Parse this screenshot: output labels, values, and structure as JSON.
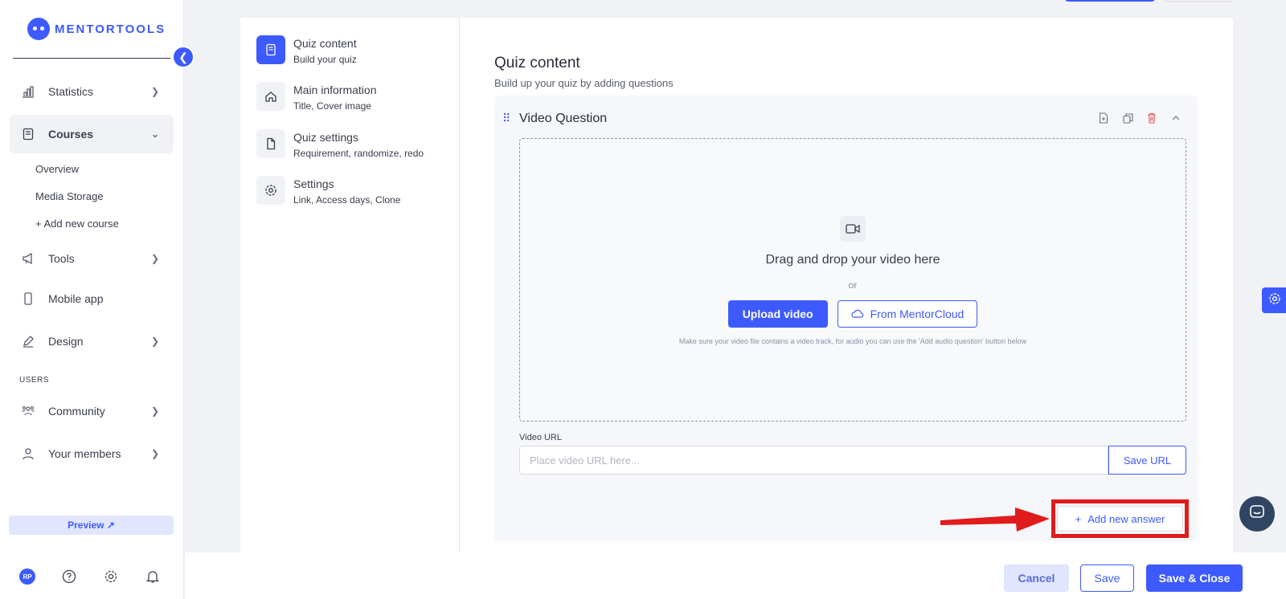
{
  "brand": {
    "name": "MENTORTOOLS"
  },
  "sidebar": {
    "items": [
      {
        "label": "Statistics",
        "icon": "bar-chart-icon"
      },
      {
        "label": "Courses",
        "icon": "book-icon"
      },
      {
        "label": "Tools",
        "icon": "megaphone-icon"
      },
      {
        "label": "Mobile app",
        "icon": "phone-icon"
      },
      {
        "label": "Design",
        "icon": "pencil-icon"
      },
      {
        "label": "Community",
        "icon": "people-icon"
      },
      {
        "label": "Your members",
        "icon": "user-icon"
      }
    ],
    "courses_sub": [
      "Overview",
      "Media Storage",
      "+ Add new course"
    ],
    "section_users": "USERS",
    "preview_label": "Preview ↗",
    "avatar_initials": "RP"
  },
  "steps": [
    {
      "title": "Quiz content",
      "sub": "Build your quiz"
    },
    {
      "title": "Main information",
      "sub": "Title, Cover image"
    },
    {
      "title": "Quiz settings",
      "sub": "Requirement, randomize, redo"
    },
    {
      "title": "Settings",
      "sub": "Link, Access days, Clone"
    }
  ],
  "content": {
    "title": "Quiz content",
    "subtitle": "Build up your quiz by adding questions"
  },
  "question": {
    "title": "Video Question",
    "dropzone_text": "Drag and drop your video here",
    "or_text": "or",
    "upload_label": "Upload video",
    "cloud_label": "From MentorCloud",
    "hint": "Make sure your video file contains a video track, for audio you can use the 'Add audio question' button below",
    "url_label": "Video URL",
    "url_placeholder": "Place video URL here...",
    "url_value": "",
    "save_url_label": "Save URL",
    "add_answer_label": "Add new answer"
  },
  "footer": {
    "cancel_label": "Cancel",
    "save_label": "Save",
    "save_close_label": "Save & Close"
  },
  "colors": {
    "accent": "#3d5afe",
    "highlight": "#e01c1c",
    "delete": "#e55353"
  }
}
